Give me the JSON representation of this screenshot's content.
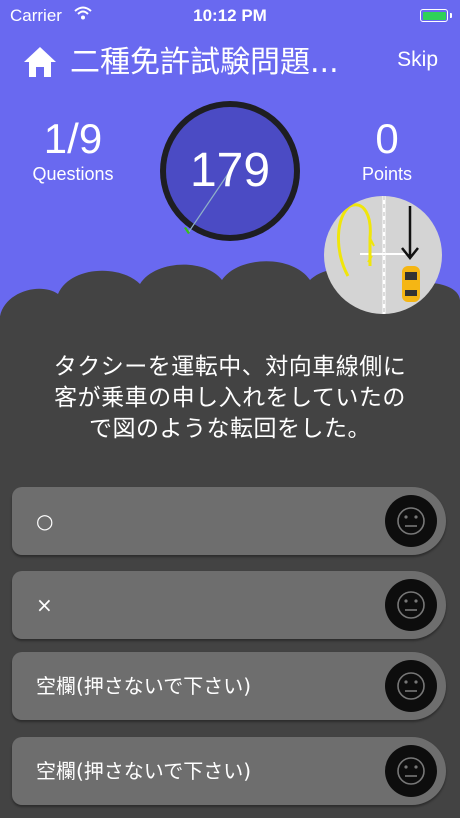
{
  "status_bar": {
    "carrier": "Carrier",
    "time": "10:12 PM"
  },
  "header": {
    "title": "二種免許試験問題...",
    "skip_label": "Skip"
  },
  "stats": {
    "progress": "1/9",
    "progress_label": "Questions",
    "points": "0",
    "points_label": "Points"
  },
  "timer": {
    "value": "179"
  },
  "question": {
    "line1": "タクシーを運転中、対向車線側に",
    "line2": "客が乗車の申し入れをしていたの",
    "line3": "で図のような転回をした。"
  },
  "answers": [
    {
      "label": "○"
    },
    {
      "label": "×"
    },
    {
      "label": "空欄(押さないで下さい)"
    },
    {
      "label": "空欄(押さないで下さい)"
    }
  ],
  "colors": {
    "background": "#6969f0",
    "panel": "#434343",
    "timer_face": "#4b4bc4",
    "answer": "#6e6e6e",
    "battery": "#2fd158"
  }
}
